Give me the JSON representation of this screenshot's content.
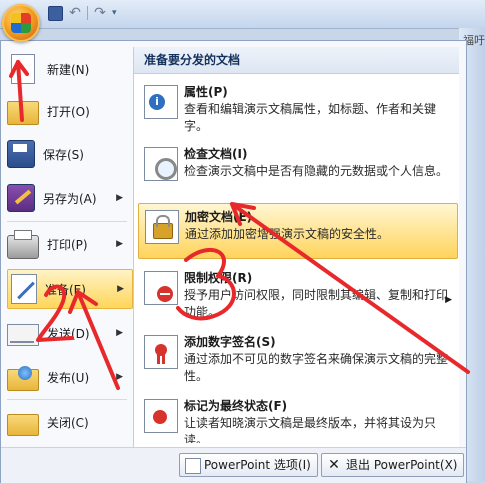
{
  "qat": {
    "undo": "↶",
    "redo": "↷",
    "dropdown": "▾"
  },
  "strip": {
    "tab_fragment": "福吁"
  },
  "left_menu": [
    {
      "label": "新建(N)",
      "icon": "new-document-icon",
      "arrow": ""
    },
    {
      "label": "打开(O)",
      "icon": "open-folder-icon",
      "arrow": ""
    },
    {
      "label": "保存(S)",
      "icon": "save-disk-icon",
      "arrow": ""
    },
    {
      "label": "另存为(A)",
      "icon": "save-as-icon",
      "arrow": "▶"
    },
    {
      "label": "打印(P)",
      "icon": "printer-icon",
      "arrow": "▶"
    },
    {
      "label": "准备(E)",
      "icon": "prepare-icon",
      "arrow": "▶"
    },
    {
      "label": "发送(D)",
      "icon": "send-icon",
      "arrow": "▶"
    },
    {
      "label": "发布(U)",
      "icon": "publish-icon",
      "arrow": "▶"
    },
    {
      "label": "关闭(C)",
      "icon": "close-folder-icon",
      "arrow": ""
    }
  ],
  "right_panel": {
    "heading": "准备要分发的文档",
    "entries": [
      {
        "title": "属性(P)",
        "desc": "查看和编辑演示文稿属性，如标题、作者和关键字。",
        "icon": "properties-icon"
      },
      {
        "title": "检查文档(I)",
        "desc": "检查演示文稿中是否有隐藏的元数据或个人信息。",
        "icon": "inspect-document-icon"
      },
      {
        "title": "加密文档(E)",
        "desc": "通过添加加密增强演示文稿的安全性。",
        "icon": "encrypt-lock-icon"
      },
      {
        "title": "限制权限(R)",
        "desc": "授予用户访问权限，同时限制其编辑、复制和打印功能。",
        "icon": "restrict-permission-icon",
        "arrow": "▶"
      },
      {
        "title": "添加数字签名(S)",
        "desc": "通过添加不可见的数字签名来确保演示文稿的完整性。",
        "icon": "digital-signature-icon"
      },
      {
        "title": "标记为最终状态(F)",
        "desc": "让读者知晓演示文稿是最终版本，并将其设为只读。",
        "icon": "mark-final-icon"
      }
    ]
  },
  "bottom": {
    "options_label": "PowerPoint 选项(I)",
    "exit_label": "退出 PowerPoint(X)"
  },
  "annotations": [
    "1",
    "2",
    "3"
  ],
  "colors": {
    "annotation": "#e8282a",
    "highlight": "#ffd65a"
  }
}
